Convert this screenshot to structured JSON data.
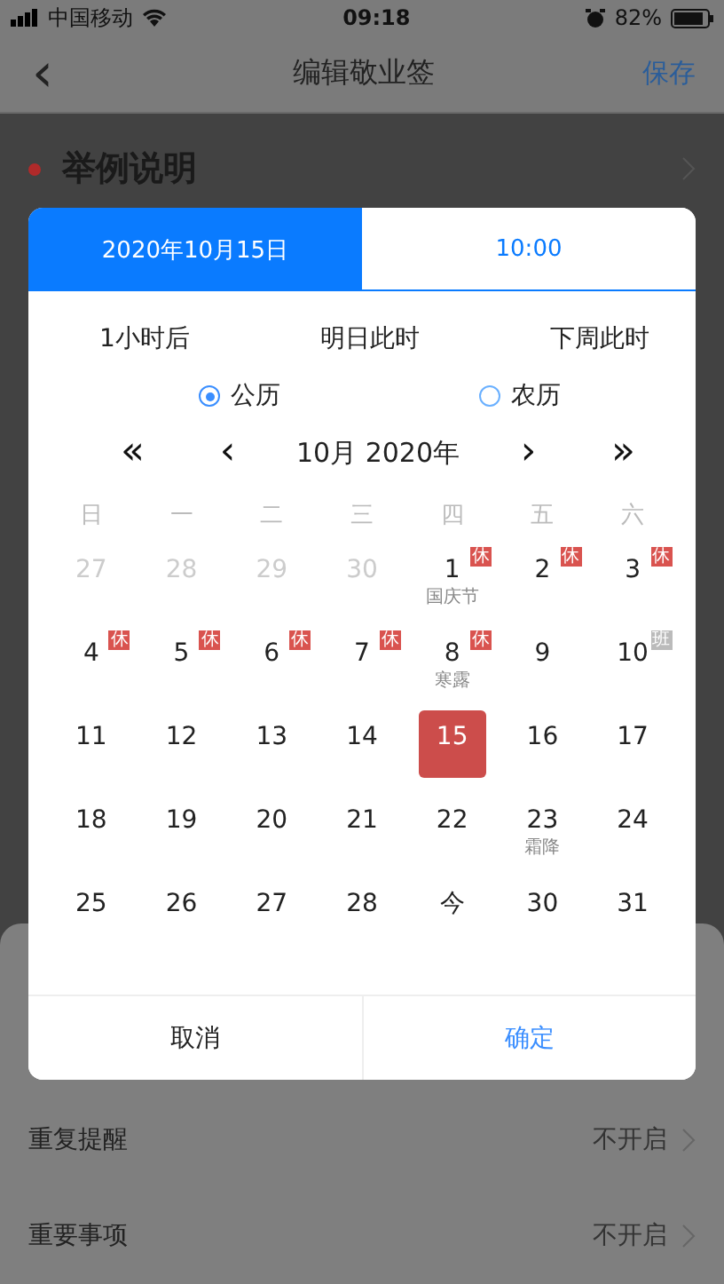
{
  "status_bar": {
    "carrier": "中国移动",
    "time": "09:18",
    "battery": "82%"
  },
  "nav": {
    "back": "‹",
    "title": "编辑敬业签",
    "action": "保存"
  },
  "note": {
    "title": "举例说明",
    "color": "#b02a2a"
  },
  "settings": [
    {
      "label": "重复提醒",
      "value": "不开启"
    },
    {
      "label": "重要事项",
      "value": "不开启"
    }
  ],
  "dialog": {
    "tabs": [
      {
        "label": "2020年10月15日",
        "selected": true
      },
      {
        "label": "10:00",
        "selected": false
      }
    ],
    "quick": [
      "1小时后",
      "明日此时",
      "下周此时"
    ],
    "calendars": [
      {
        "label": "公历",
        "selected": true
      },
      {
        "label": "农历",
        "selected": false
      }
    ],
    "nav": {
      "prev_year": "«",
      "prev_month": "‹",
      "title": "10月 2020年",
      "next_month": "›",
      "next_year": "»"
    },
    "weekdays": [
      "日",
      "一",
      "二",
      "三",
      "四",
      "五",
      "六"
    ],
    "days": [
      {
        "day": "27",
        "muted": true,
        "selected": false
      },
      {
        "day": "28",
        "muted": true,
        "selected": false
      },
      {
        "day": "29",
        "muted": true,
        "selected": false
      },
      {
        "day": "30",
        "muted": true,
        "selected": false
      },
      {
        "day": "1",
        "muted": false,
        "selected": false,
        "badge": {
          "text": "休",
          "kind": "rest"
        },
        "sub": "国庆节"
      },
      {
        "day": "2",
        "muted": false,
        "selected": false,
        "badge": {
          "text": "休",
          "kind": "rest"
        }
      },
      {
        "day": "3",
        "muted": false,
        "selected": false,
        "badge": {
          "text": "休",
          "kind": "rest"
        }
      },
      {
        "day": "4",
        "muted": false,
        "selected": false,
        "badge": {
          "text": "休",
          "kind": "rest"
        }
      },
      {
        "day": "5",
        "muted": false,
        "selected": false,
        "badge": {
          "text": "休",
          "kind": "rest"
        }
      },
      {
        "day": "6",
        "muted": false,
        "selected": false,
        "badge": {
          "text": "休",
          "kind": "rest"
        }
      },
      {
        "day": "7",
        "muted": false,
        "selected": false,
        "badge": {
          "text": "休",
          "kind": "rest"
        }
      },
      {
        "day": "8",
        "muted": false,
        "selected": false,
        "badge": {
          "text": "休",
          "kind": "rest"
        },
        "sub": "寒露"
      },
      {
        "day": "9",
        "muted": false,
        "selected": false
      },
      {
        "day": "10",
        "muted": false,
        "selected": false,
        "badge": {
          "text": "班",
          "kind": "work"
        }
      },
      {
        "day": "11",
        "muted": false,
        "selected": false
      },
      {
        "day": "12",
        "muted": false,
        "selected": false
      },
      {
        "day": "13",
        "muted": false,
        "selected": false
      },
      {
        "day": "14",
        "muted": false,
        "selected": false
      },
      {
        "day": "15",
        "muted": false,
        "selected": true
      },
      {
        "day": "16",
        "muted": false,
        "selected": false
      },
      {
        "day": "17",
        "muted": false,
        "selected": false
      },
      {
        "day": "18",
        "muted": false,
        "selected": false
      },
      {
        "day": "19",
        "muted": false,
        "selected": false
      },
      {
        "day": "20",
        "muted": false,
        "selected": false
      },
      {
        "day": "21",
        "muted": false,
        "selected": false
      },
      {
        "day": "22",
        "muted": false,
        "selected": false
      },
      {
        "day": "23",
        "muted": false,
        "selected": false,
        "sub": "霜降"
      },
      {
        "day": "24",
        "muted": false,
        "selected": false
      },
      {
        "day": "25",
        "muted": false,
        "selected": false
      },
      {
        "day": "26",
        "muted": false,
        "selected": false
      },
      {
        "day": "27",
        "muted": false,
        "selected": false
      },
      {
        "day": "28",
        "muted": false,
        "selected": false
      },
      {
        "day": "今",
        "muted": false,
        "selected": false
      },
      {
        "day": "30",
        "muted": false,
        "selected": false
      },
      {
        "day": "31",
        "muted": false,
        "selected": false
      }
    ],
    "buttons": [
      {
        "label": "取消",
        "kind": "cancel"
      },
      {
        "label": "确定",
        "kind": "confirm"
      }
    ]
  }
}
